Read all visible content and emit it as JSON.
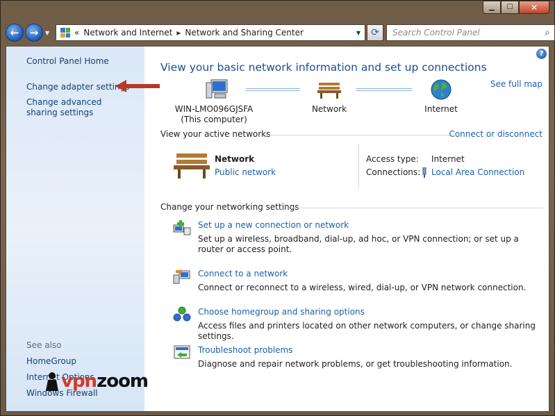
{
  "window": {
    "caption": {
      "minimize_glyph": "▁",
      "maximize_glyph": "☐",
      "close_glyph": "✕"
    }
  },
  "navbar": {
    "back_glyph": "←",
    "forward_glyph": "→",
    "crumb_overflow": "«",
    "breadcrumbs": [
      "Network and Internet",
      "Network and Sharing Center"
    ],
    "crumb_separator": "▸",
    "search_placeholder": "Search Control Panel"
  },
  "sidebar": {
    "items": [
      {
        "label": "Control Panel Home"
      },
      {
        "label": "Change adapter settings"
      },
      {
        "label": "Change advanced sharing settings"
      }
    ],
    "see_also_heading": "See also",
    "see_also": [
      {
        "label": "HomeGroup"
      },
      {
        "label": "Internet Options"
      },
      {
        "label": "Windows Firewall"
      }
    ]
  },
  "main": {
    "help_glyph": "?",
    "title": "View your basic network information and set up connections",
    "see_full_map": "See full map",
    "map": {
      "computer": {
        "name": "WIN-LMO096GJSFA",
        "sub": "(This computer)"
      },
      "network": {
        "name": "Network"
      },
      "internet": {
        "name": "Internet"
      }
    },
    "active_networks": {
      "heading": "View your active networks",
      "connect_link": "Connect or disconnect",
      "network_name": "Network",
      "network_type": "Public network",
      "access_type_label": "Access type:",
      "access_type_value": "Internet",
      "connections_label": "Connections:",
      "connections_value": "Local Area Connection"
    },
    "settings": {
      "heading": "Change your networking settings",
      "tasks": [
        {
          "title": "Set up a new connection or network",
          "description": "Set up a wireless, broadband, dial-up, ad hoc, or VPN connection; or set up a router or access point."
        },
        {
          "title": "Connect to a network",
          "description": "Connect or reconnect to a wireless, wired, dial-up, or VPN network connection."
        },
        {
          "title": "Choose homegroup and sharing options",
          "description": "Access files and printers located on other network computers, or change sharing settings."
        },
        {
          "title": "Troubleshoot problems",
          "description": "Diagnose and repair network problems, or get troubleshooting information."
        }
      ]
    }
  },
  "watermark": {
    "part1": "vpn",
    "part2": "zoom"
  },
  "colors": {
    "link": "#1c5fad",
    "title": "#1e4a96",
    "sidebar_link": "#163f73",
    "arrow": "#b53a25",
    "frame": "#6f5d47"
  }
}
